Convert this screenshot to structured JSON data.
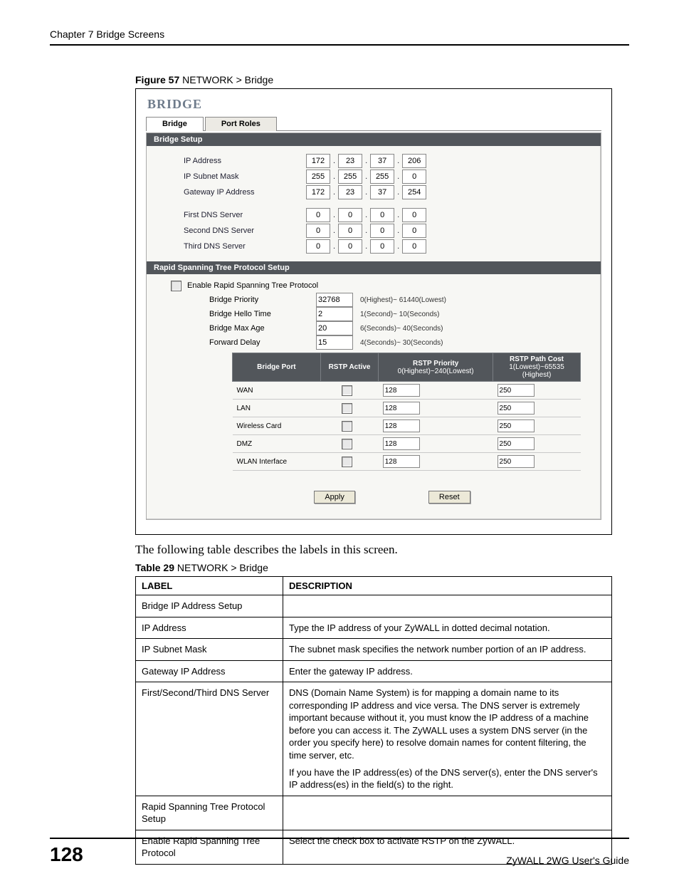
{
  "chapter_header": "Chapter 7 Bridge Screens",
  "figure": {
    "prefix": "Figure 57",
    "title": "   NETWORK > Bridge"
  },
  "screen": {
    "title": "BRIDGE",
    "tabs": [
      "Bridge",
      "Port Roles"
    ],
    "section1": "Bridge Setup",
    "labels": {
      "ip": "IP Address",
      "mask": "IP Subnet Mask",
      "gw": "Gateway IP Address",
      "dns1": "First DNS Server",
      "dns2": "Second DNS Server",
      "dns3": "Third DNS Server"
    },
    "ip": [
      "172",
      "23",
      "37",
      "206"
    ],
    "mask": [
      "255",
      "255",
      "255",
      "0"
    ],
    "gw": [
      "172",
      "23",
      "37",
      "254"
    ],
    "dns1": [
      "0",
      "0",
      "0",
      "0"
    ],
    "dns2": [
      "0",
      "0",
      "0",
      "0"
    ],
    "dns3": [
      "0",
      "0",
      "0",
      "0"
    ],
    "section2": "Rapid Spanning Tree Protocol Setup",
    "enable_label": "Enable Rapid Spanning Tree Protocol",
    "rstp": {
      "priority": {
        "lab": "Bridge Priority",
        "val": "32768",
        "hint": "0(Highest)~ 61440(Lowest)"
      },
      "hello": {
        "lab": "Bridge Hello Time",
        "val": "2",
        "hint": "1(Second)~ 10(Seconds)"
      },
      "maxage": {
        "lab": "Bridge Max Age",
        "val": "20",
        "hint": "6(Seconds)~ 40(Seconds)"
      },
      "fwd": {
        "lab": "Forward Delay",
        "val": "15",
        "hint": "4(Seconds)~ 30(Seconds)"
      }
    },
    "thead": {
      "c1": "Bridge Port",
      "c2": "RSTP Active",
      "c3a": "RSTP Priority",
      "c3b": "0(Highest)~240(Lowest)",
      "c4a": "RSTP Path Cost",
      "c4b": "1(Lowest)~65535 (Highest)"
    },
    "ports": [
      {
        "name": "WAN",
        "prio": "128",
        "cost": "250"
      },
      {
        "name": "LAN",
        "prio": "128",
        "cost": "250"
      },
      {
        "name": "Wireless Card",
        "prio": "128",
        "cost": "250"
      },
      {
        "name": "DMZ",
        "prio": "128",
        "cost": "250"
      },
      {
        "name": "WLAN Interface",
        "prio": "128",
        "cost": "250"
      }
    ],
    "apply": "Apply",
    "reset": "Reset"
  },
  "following": "The following table describes the labels in this screen.",
  "table_caption": {
    "prefix": "Table 29",
    "title": "   NETWORK > Bridge"
  },
  "thead": {
    "c1": "LABEL",
    "c2": "DESCRIPTION"
  },
  "trows": {
    "r0": {
      "l": "Bridge IP Address Setup",
      "d": ""
    },
    "r1": {
      "l": "IP Address",
      "d": "Type the IP address of your ZyWALL in dotted decimal notation."
    },
    "r2": {
      "l": "IP Subnet Mask",
      "d": "The subnet mask specifies the network number portion of an IP address."
    },
    "r3": {
      "l": "Gateway IP Address",
      "d": "Enter the gateway IP address."
    },
    "r4": {
      "l": "First/Second/Third DNS Server",
      "d1": "DNS (Domain Name System) is for mapping a domain name to its corresponding IP address and vice versa. The DNS server is extremely important because without it, you must know the IP address of a machine before you can access it. The ZyWALL uses a system DNS server (in the order you specify here) to resolve domain names for content filtering, the time server, etc.",
      "d2": "If you have the IP address(es) of the DNS server(s), enter the DNS server's IP address(es) in the field(s) to the right."
    },
    "r5": {
      "l": "Rapid Spanning Tree Protocol Setup",
      "d": ""
    },
    "r6": {
      "l": "Enable Rapid Spanning Tree Protocol",
      "d": "Select the check box to activate RSTP on the ZyWALL."
    }
  },
  "footer": {
    "page": "128",
    "guide": "ZyWALL 2WG User's Guide"
  }
}
